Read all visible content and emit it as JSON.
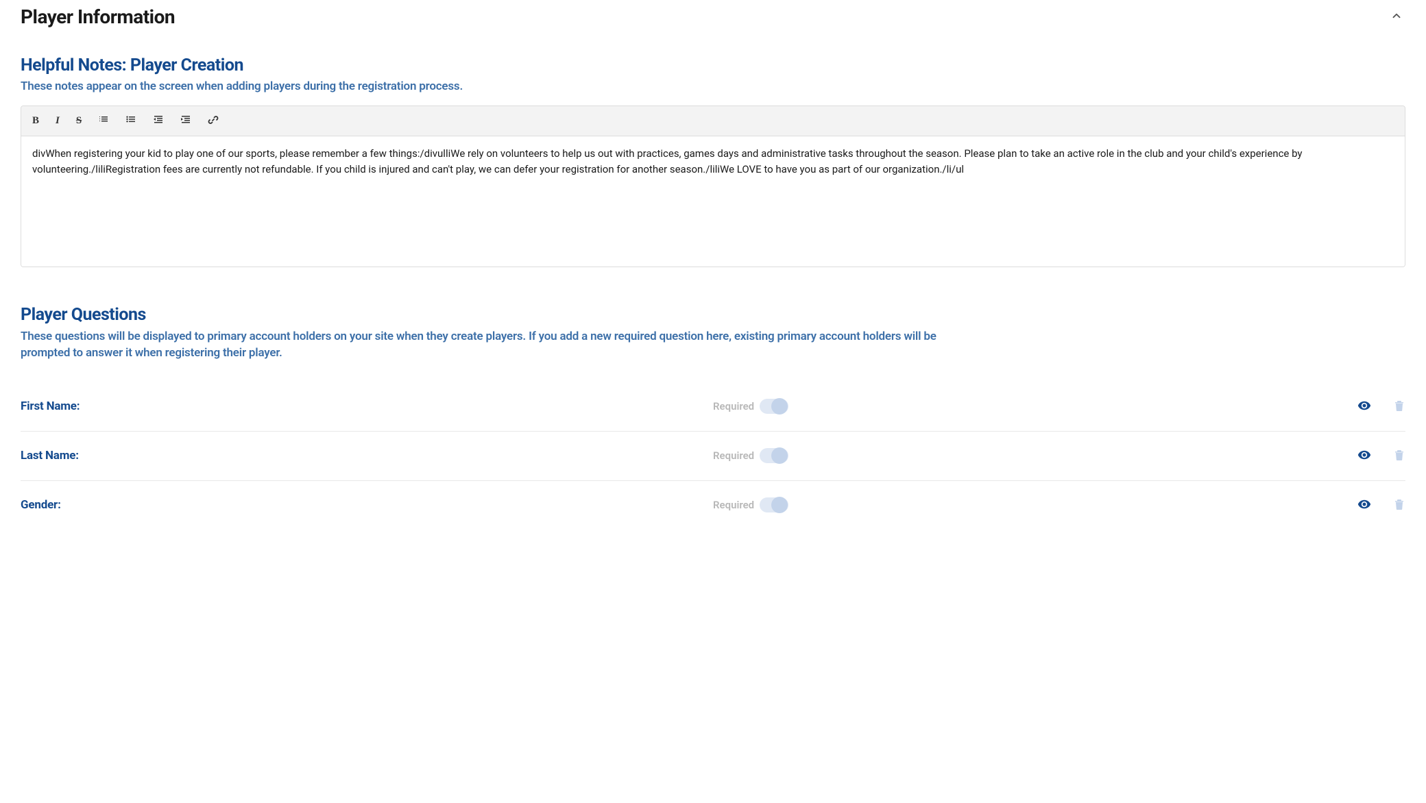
{
  "header": {
    "title": "Player Information"
  },
  "notes_section": {
    "title": "Helpful Notes: Player Creation",
    "subtitle": "These notes appear on the screen when adding players during the registration process.",
    "editor_content": "divWhen registering your kid to play one of our sports, please remember a few things:/divulliWe rely on volunteers to help us out with practices, games days and administrative tasks throughout the season. Please plan to take an active role in the club and your child's experience by volunteering./liliRegistration fees are currently not refundable. If you child is injured and can't play, we can defer your registration for another season./liliWe LOVE to have you as part of our organization./li/ul"
  },
  "questions_section": {
    "title": "Player Questions",
    "subtitle": "These questions will be displayed to primary account holders on your site when they create players. If you add a new required question here, existing primary account holders will be prompted to answer it when registering their player.",
    "required_label": "Required",
    "questions": [
      {
        "label": "First Name:"
      },
      {
        "label": "Last Name:"
      },
      {
        "label": "Gender:"
      }
    ]
  }
}
